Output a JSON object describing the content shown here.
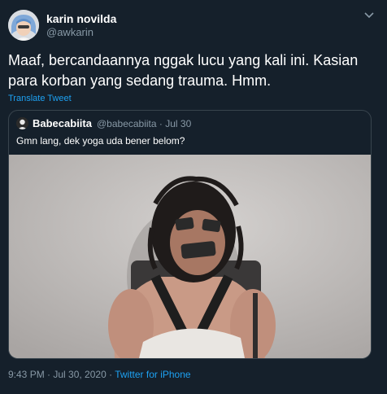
{
  "tweet": {
    "author_name": "karin novilda",
    "author_handle": "@awkarin",
    "text": "Maaf, bercandaannya nggak lucu yang kali ini. Kasian para korban yang sedang trauma. Hmm.",
    "translate_label": "Translate Tweet",
    "timestamp": "9:43 PM · Jul 30, 2020 · ",
    "source": "Twitter for iPhone",
    "more_icon": "chevron-down-icon"
  },
  "quoted_tweet": {
    "author_name": "Babecabiita",
    "author_handle": "@babecabiita",
    "date": "· Jul 30",
    "text": "Gmn lang, dek yoga uda bener belom?",
    "media_description_icon": "photo"
  },
  "colors": {
    "background": "#15202b",
    "text_primary": "#ffffff",
    "text_secondary": "#8899a6",
    "link": "#1da1f2",
    "border": "#38444d"
  }
}
